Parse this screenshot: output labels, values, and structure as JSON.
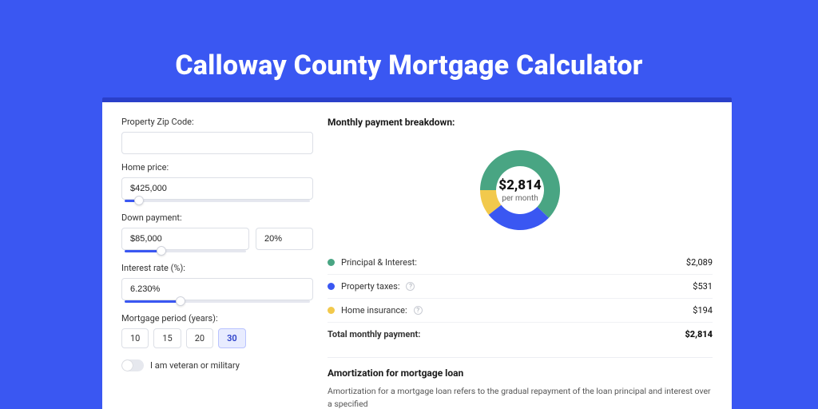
{
  "title": "Calloway County Mortgage Calculator",
  "form": {
    "zip_label": "Property Zip Code:",
    "zip_value": "",
    "home_price_label": "Home price:",
    "home_price_value": "$425,000",
    "down_label": "Down payment:",
    "down_value": "$85,000",
    "down_pct_value": "20%",
    "rate_label": "Interest rate (%):",
    "rate_value": "6.230%",
    "period_label": "Mortgage period (years):",
    "periods": [
      "10",
      "15",
      "20",
      "30"
    ],
    "period_active_index": 3,
    "veteran_label": "I am veteran or military"
  },
  "breakdown": {
    "title": "Monthly payment breakdown:",
    "center_amount": "$2,814",
    "center_sub": "per month",
    "items": [
      {
        "color": "#49a583",
        "name": "Principal & Interest:",
        "help": false,
        "value": "$2,089"
      },
      {
        "color": "#3a57f2",
        "name": "Property taxes:",
        "help": true,
        "value": "$531"
      },
      {
        "color": "#f2c94c",
        "name": "Home insurance:",
        "help": true,
        "value": "$194"
      }
    ],
    "total_label": "Total monthly payment:",
    "total_value": "$2,814"
  },
  "amortization": {
    "title": "Amortization for mortgage loan",
    "body": "Amortization for a mortgage loan refers to the gradual repayment of the loan principal and interest over a specified"
  },
  "chart_data": {
    "type": "pie",
    "title": "Monthly payment breakdown",
    "categories": [
      "Principal & Interest",
      "Property taxes",
      "Home insurance"
    ],
    "values": [
      2089,
      531,
      194
    ],
    "colors": [
      "#49a583",
      "#3a57f2",
      "#f2c94c"
    ],
    "total": 2814,
    "center_label": "$2,814 per month"
  }
}
